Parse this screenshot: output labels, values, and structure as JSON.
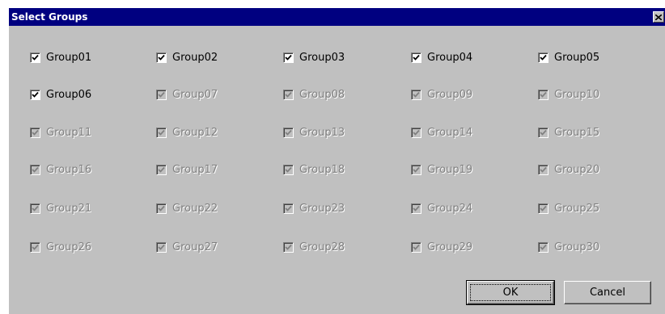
{
  "dialog": {
    "title": "Select Groups",
    "title_bar_color": "#000080"
  },
  "groups": [
    {
      "label": "Group01",
      "checked": true,
      "enabled": true
    },
    {
      "label": "Group02",
      "checked": true,
      "enabled": true
    },
    {
      "label": "Group03",
      "checked": true,
      "enabled": true
    },
    {
      "label": "Group04",
      "checked": true,
      "enabled": true
    },
    {
      "label": "Group05",
      "checked": true,
      "enabled": true
    },
    {
      "label": "Group06",
      "checked": true,
      "enabled": true
    },
    {
      "label": "Group07",
      "checked": true,
      "enabled": false
    },
    {
      "label": "Group08",
      "checked": true,
      "enabled": false
    },
    {
      "label": "Group09",
      "checked": true,
      "enabled": false
    },
    {
      "label": "Group10",
      "checked": true,
      "enabled": false
    },
    {
      "label": "Group11",
      "checked": true,
      "enabled": false
    },
    {
      "label": "Group12",
      "checked": true,
      "enabled": false
    },
    {
      "label": "Group13",
      "checked": true,
      "enabled": false
    },
    {
      "label": "Group14",
      "checked": true,
      "enabled": false
    },
    {
      "label": "Group15",
      "checked": true,
      "enabled": false
    },
    {
      "label": "Group16",
      "checked": true,
      "enabled": false
    },
    {
      "label": "Group17",
      "checked": true,
      "enabled": false
    },
    {
      "label": "Group18",
      "checked": true,
      "enabled": false
    },
    {
      "label": "Group19",
      "checked": true,
      "enabled": false
    },
    {
      "label": "Group20",
      "checked": true,
      "enabled": false
    },
    {
      "label": "Group21",
      "checked": true,
      "enabled": false
    },
    {
      "label": "Group22",
      "checked": true,
      "enabled": false
    },
    {
      "label": "Group23",
      "checked": true,
      "enabled": false
    },
    {
      "label": "Group24",
      "checked": true,
      "enabled": false
    },
    {
      "label": "Group25",
      "checked": true,
      "enabled": false
    },
    {
      "label": "Group26",
      "checked": true,
      "enabled": false
    },
    {
      "label": "Group27",
      "checked": true,
      "enabled": false
    },
    {
      "label": "Group28",
      "checked": true,
      "enabled": false
    },
    {
      "label": "Group29",
      "checked": true,
      "enabled": false
    },
    {
      "label": "Group30",
      "checked": true,
      "enabled": false
    }
  ],
  "buttons": {
    "ok_label": "OK",
    "cancel_label": "Cancel"
  },
  "icons": {
    "close": "close-icon",
    "check": "checkmark-icon"
  }
}
